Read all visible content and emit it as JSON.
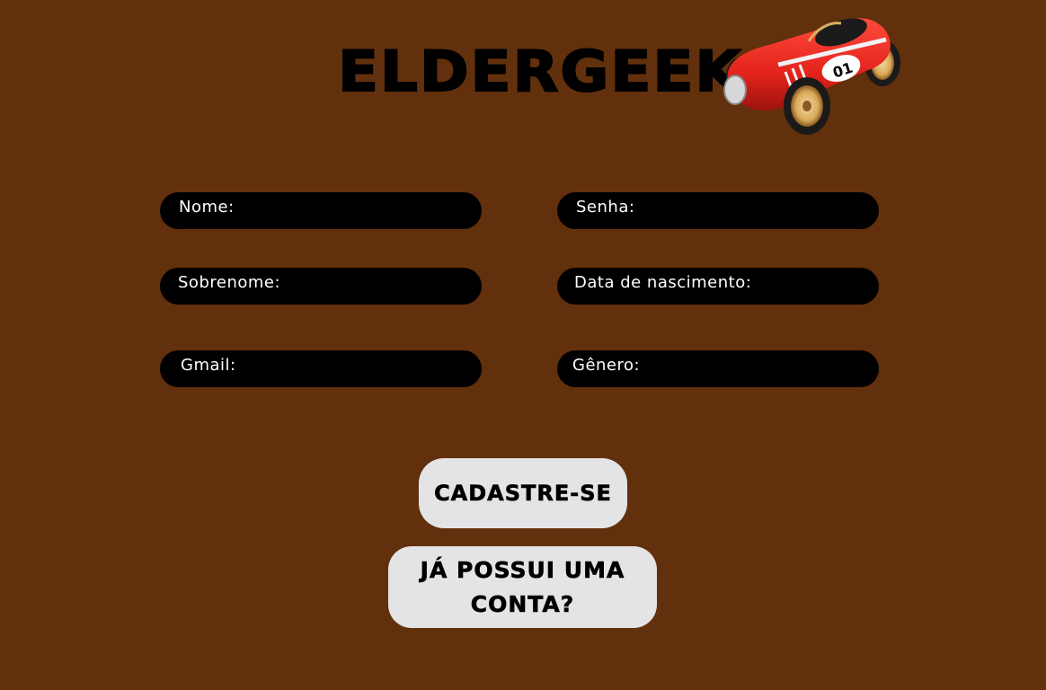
{
  "header": {
    "brand": "ELDERGEEK",
    "logo_icon": "red-race-car-toy-icon",
    "car_number": "01"
  },
  "form": {
    "fields": [
      {
        "id": "nome",
        "label": "Nome:"
      },
      {
        "id": "senha",
        "label": "Senha:"
      },
      {
        "id": "sobrenome",
        "label": "Sobrenome:"
      },
      {
        "id": "data-nascimento",
        "label": "Data de nascimento:"
      },
      {
        "id": "gmail",
        "label": "Gmail:"
      },
      {
        "id": "genero",
        "label": "Gênero:"
      }
    ]
  },
  "actions": {
    "register_label": "CADASTRE-SE",
    "login_label": "JÁ POSSUI UMA CONTA?"
  },
  "colors": {
    "background": "#62300d",
    "field": "#000000",
    "button": "#e4e4e6",
    "car_red": "#e3231c"
  }
}
